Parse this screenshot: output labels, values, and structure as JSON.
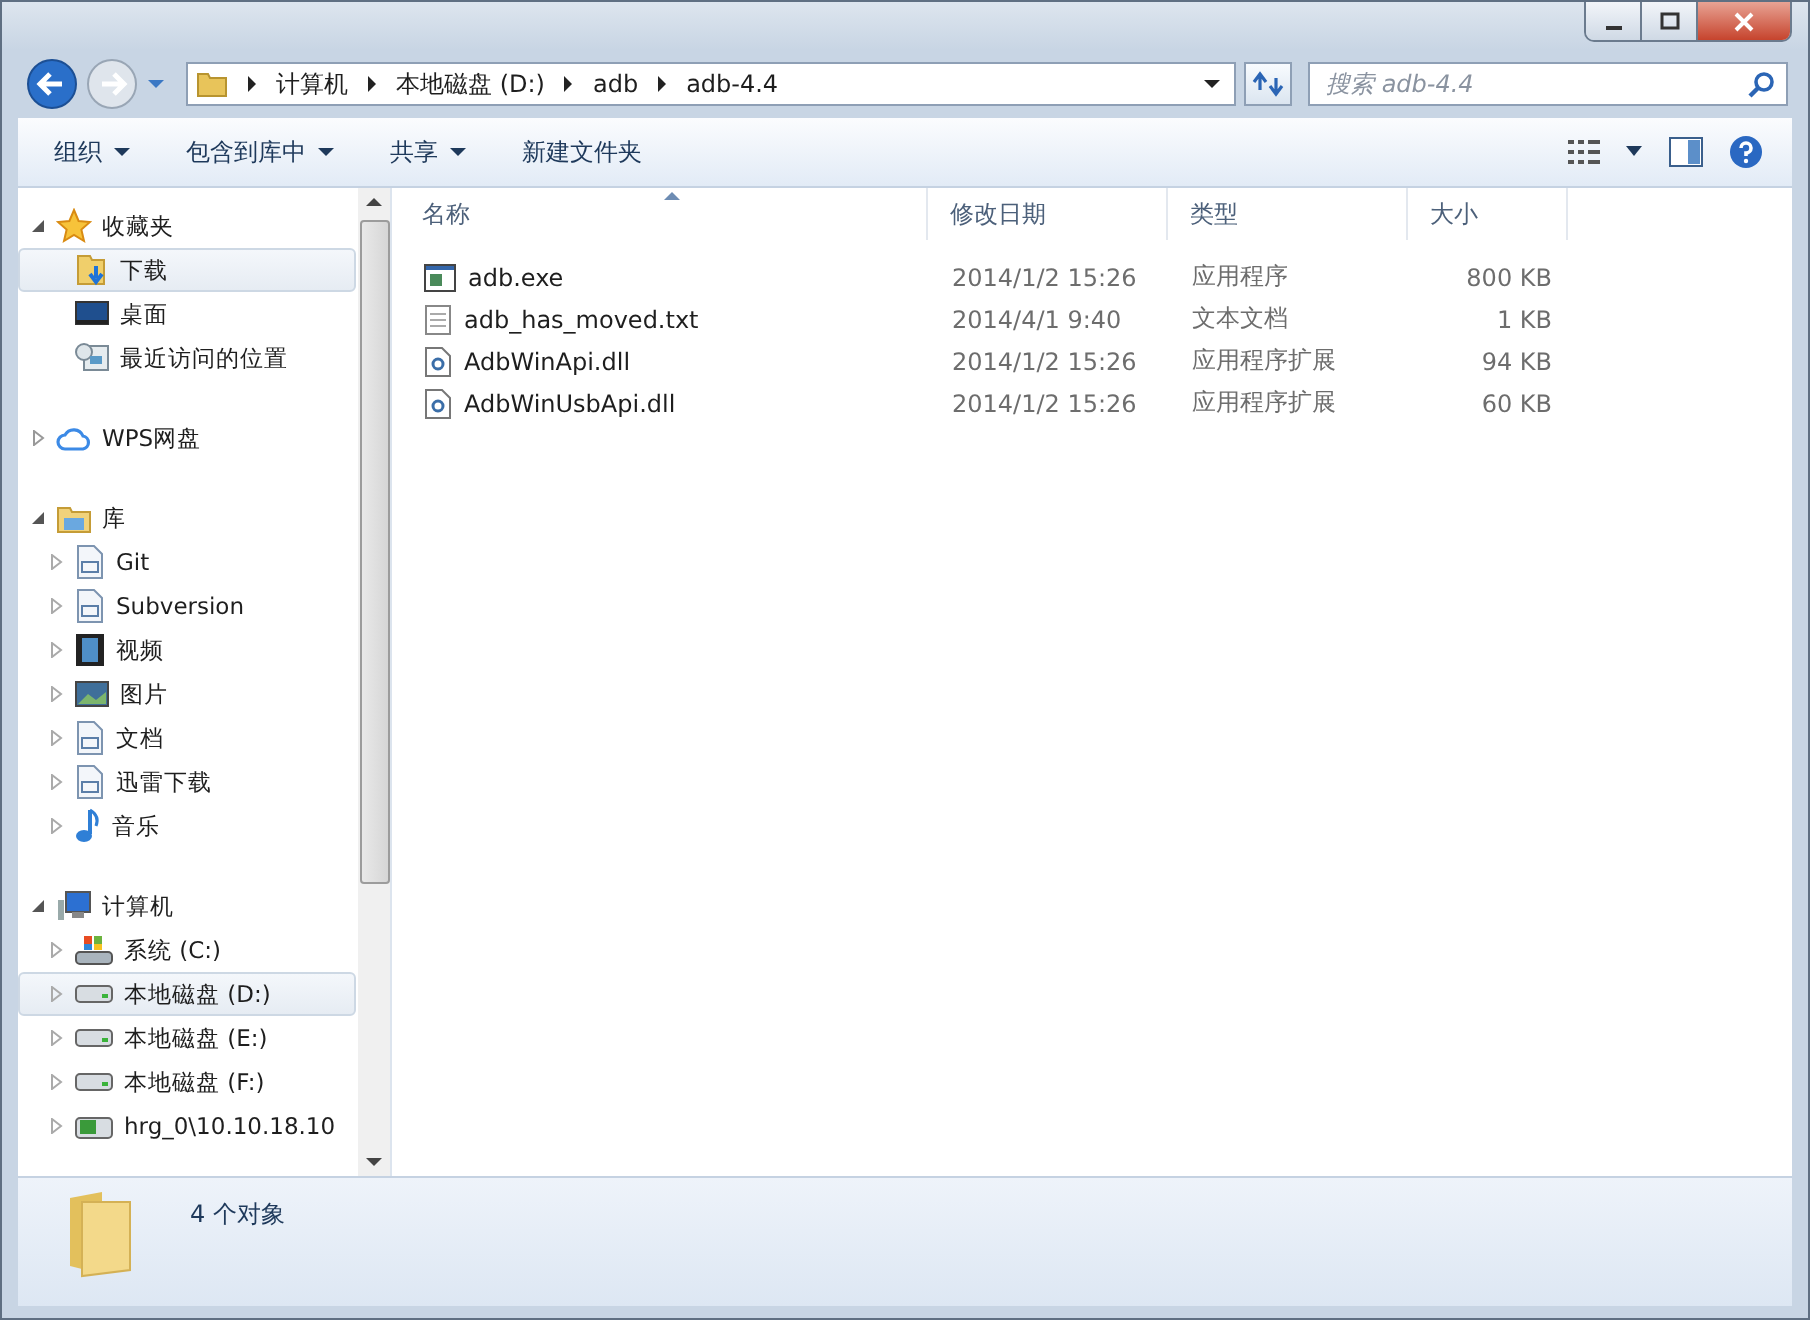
{
  "address": {
    "crumbs": [
      "计算机",
      "本地磁盘 (D:)",
      "adb",
      "adb-4.4"
    ]
  },
  "search": {
    "placeholder": "搜索 adb-4.4"
  },
  "toolbar": {
    "buttons": [
      {
        "label": "组织",
        "dropdown": true
      },
      {
        "label": "包含到库中",
        "dropdown": true
      },
      {
        "label": "共享",
        "dropdown": true
      },
      {
        "label": "新建文件夹",
        "dropdown": false
      }
    ]
  },
  "nav": [
    {
      "label": "收藏夹",
      "kind": "star",
      "expanded": true,
      "children": [
        {
          "label": "下载",
          "kind": "download",
          "expandable": false,
          "selected": true
        },
        {
          "label": "桌面",
          "kind": "desktop",
          "expandable": false,
          "selected": false
        },
        {
          "label": "最近访问的位置",
          "kind": "recent",
          "expandable": false,
          "selected": false
        }
      ]
    },
    {
      "label": "WPS网盘",
      "kind": "cloud",
      "expanded": false
    },
    {
      "label": "库",
      "kind": "library",
      "expanded": true,
      "children": [
        {
          "label": "Git",
          "kind": "doc",
          "expandable": true,
          "selected": false
        },
        {
          "label": "Subversion",
          "kind": "doc",
          "expandable": true,
          "selected": false
        },
        {
          "label": "视频",
          "kind": "video",
          "expandable": true,
          "selected": false
        },
        {
          "label": "图片",
          "kind": "picture",
          "expandable": true,
          "selected": false
        },
        {
          "label": "文档",
          "kind": "doc",
          "expandable": true,
          "selected": false
        },
        {
          "label": "迅雷下载",
          "kind": "doc",
          "expandable": true,
          "selected": false
        },
        {
          "label": "音乐",
          "kind": "music",
          "expandable": true,
          "selected": false
        }
      ]
    },
    {
      "label": "计算机",
      "kind": "computer",
      "expanded": true,
      "children": [
        {
          "label": "系统 (C:)",
          "kind": "sysdrive",
          "expandable": true,
          "selected": false
        },
        {
          "label": "本地磁盘 (D:)",
          "kind": "drive",
          "expandable": true,
          "selected": true
        },
        {
          "label": "本地磁盘 (E:)",
          "kind": "drive",
          "expandable": true,
          "selected": false
        },
        {
          "label": "本地磁盘 (F:)",
          "kind": "drive",
          "expandable": true,
          "selected": false
        },
        {
          "label": "hrg_0\\10.10.18.10",
          "kind": "netdrive",
          "expandable": true,
          "selected": false
        }
      ]
    }
  ],
  "table": {
    "columns": [
      {
        "label": "名称",
        "sorted": true
      },
      {
        "label": "修改日期",
        "sorted": false
      },
      {
        "label": "类型",
        "sorted": false
      },
      {
        "label": "大小",
        "sorted": false
      }
    ],
    "rows": [
      {
        "kind": "exe",
        "name": "adb.exe",
        "modified": "2014/1/2 15:26",
        "type": "应用程序",
        "size": "800 KB"
      },
      {
        "kind": "txt",
        "name": "adb_has_moved.txt",
        "modified": "2014/4/1 9:40",
        "type": "文本文档",
        "size": "1 KB"
      },
      {
        "kind": "dll",
        "name": "AdbWinApi.dll",
        "modified": "2014/1/2 15:26",
        "type": "应用程序扩展",
        "size": "94 KB"
      },
      {
        "kind": "dll",
        "name": "AdbWinUsbApi.dll",
        "modified": "2014/1/2 15:26",
        "type": "应用程序扩展",
        "size": "60 KB"
      }
    ]
  },
  "status_bar": {
    "text": "4 个对象"
  }
}
